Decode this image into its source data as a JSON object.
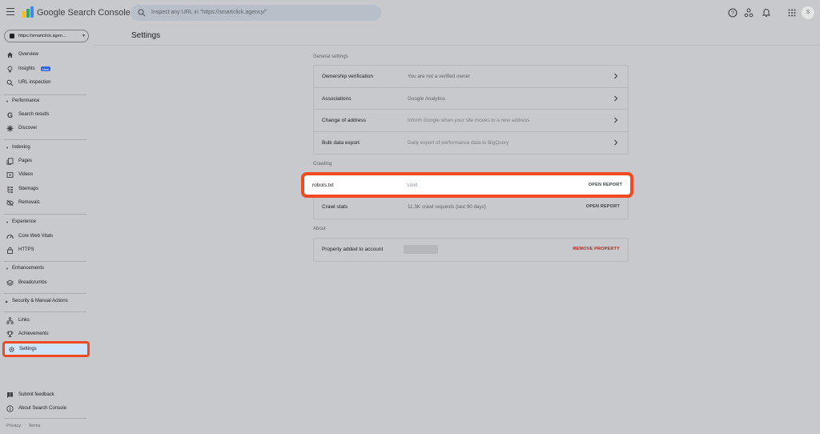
{
  "header": {
    "brand": "Google Search Console",
    "search_placeholder": "Inspect any URL in \"https://smartclick.agency/\"",
    "avatar_letter": "S"
  },
  "sidebar": {
    "property": "https://smartclick.agen...",
    "top_items": [
      {
        "label": "Overview",
        "icon": "home-icon"
      },
      {
        "label": "Insights",
        "icon": "lightbulb-icon",
        "badge": "New"
      },
      {
        "label": "URL inspection",
        "icon": "search-icon"
      }
    ],
    "performance": {
      "title": "Performance",
      "items": [
        {
          "label": "Search results",
          "icon": "google-g-icon"
        },
        {
          "label": "Discover",
          "icon": "asterisk-icon"
        }
      ]
    },
    "indexing": {
      "title": "Indexing",
      "items": [
        {
          "label": "Pages",
          "icon": "pages-icon"
        },
        {
          "label": "Videos",
          "icon": "video-icon"
        },
        {
          "label": "Sitemaps",
          "icon": "sitemap-icon"
        },
        {
          "label": "Removals",
          "icon": "visibility-off-icon"
        }
      ]
    },
    "experience": {
      "title": "Experience",
      "items": [
        {
          "label": "Core Web Vitals",
          "icon": "speed-icon"
        },
        {
          "label": "HTTPS",
          "icon": "lock-icon"
        }
      ]
    },
    "enhancements": {
      "title": "Enhancements",
      "items": [
        {
          "label": "Breadcrumbs",
          "icon": "layers-icon"
        }
      ]
    },
    "security": {
      "title": "Security & Manual Actions"
    },
    "bottom_items": [
      {
        "label": "Links",
        "icon": "link-network-icon"
      },
      {
        "label": "Achievements",
        "icon": "trophy-icon"
      }
    ],
    "settings": {
      "label": "Settings",
      "icon": "gear-icon"
    },
    "feedback": {
      "label": "Submit feedback",
      "icon": "feedback-icon"
    },
    "about": {
      "label": "About Search Console",
      "icon": "info-icon"
    },
    "footer": {
      "privacy": "Privacy",
      "terms": "Terms"
    }
  },
  "main": {
    "title": "Settings",
    "general": {
      "label": "General settings",
      "rows": [
        {
          "key": "Ownership verification",
          "value": "You are not a verified owner"
        },
        {
          "key": "Associations",
          "value": "Google Analytics"
        },
        {
          "key": "Change of address",
          "value": "Inform Google when your site moves to a new address"
        },
        {
          "key": "Bulk data export",
          "value": "Daily export of performance data to BigQuery"
        }
      ]
    },
    "crawling": {
      "label": "Crawling",
      "rows": [
        {
          "key": "robots.txt",
          "value": "Valid",
          "action": "OPEN REPORT"
        },
        {
          "key": "Crawl stats",
          "value": "11.3K crawl requests (last 90 days)",
          "action": "OPEN REPORT"
        }
      ]
    },
    "about": {
      "label": "About",
      "rows": [
        {
          "key": "Property added to account",
          "action": "REMOVE PROPERTY"
        }
      ]
    }
  },
  "colors": {
    "highlight": "#f04a23",
    "active_bg": "#cfe3f8",
    "danger": "#b3261e"
  }
}
